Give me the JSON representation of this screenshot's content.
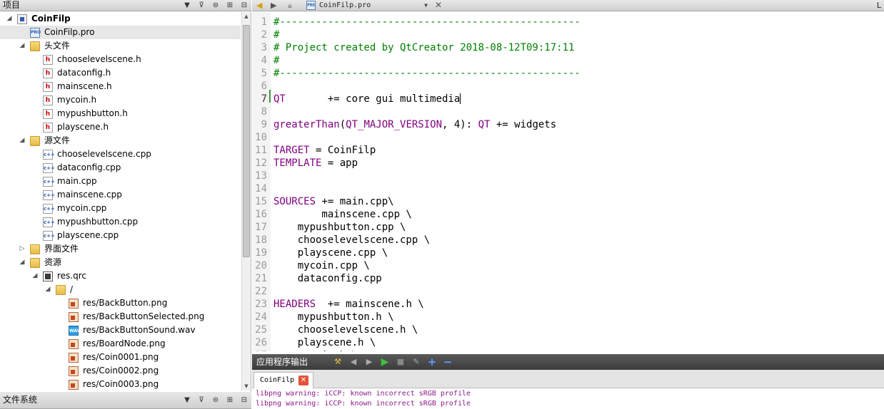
{
  "projects_panel": {
    "title": "项目",
    "tree": [
      {
        "label": "CoinFilp",
        "bold": true,
        "level": 0,
        "expanded": true,
        "icon": "project-icon"
      },
      {
        "label": "CoinFilp.pro",
        "level": 1,
        "icon": "pro-file-icon",
        "selected": true
      },
      {
        "label": "头文件",
        "level": 1,
        "expanded": true,
        "icon": "header-folder-icon"
      },
      {
        "label": "chooselevelscene.h",
        "level": 2,
        "icon": "header-file-icon"
      },
      {
        "label": "dataconfig.h",
        "level": 2,
        "icon": "header-file-icon"
      },
      {
        "label": "mainscene.h",
        "level": 2,
        "icon": "header-file-icon"
      },
      {
        "label": "mycoin.h",
        "level": 2,
        "icon": "header-file-icon"
      },
      {
        "label": "mypushbutton.h",
        "level": 2,
        "icon": "header-file-icon"
      },
      {
        "label": "playscene.h",
        "level": 2,
        "icon": "header-file-icon"
      },
      {
        "label": "源文件",
        "level": 1,
        "expanded": true,
        "icon": "source-folder-icon"
      },
      {
        "label": "chooselevelscene.cpp",
        "level": 2,
        "icon": "cpp-file-icon"
      },
      {
        "label": "dataconfig.cpp",
        "level": 2,
        "icon": "cpp-file-icon"
      },
      {
        "label": "main.cpp",
        "level": 2,
        "icon": "cpp-file-icon"
      },
      {
        "label": "mainscene.cpp",
        "level": 2,
        "icon": "cpp-file-icon"
      },
      {
        "label": "mycoin.cpp",
        "level": 2,
        "icon": "cpp-file-icon"
      },
      {
        "label": "mypushbutton.cpp",
        "level": 2,
        "icon": "cpp-file-icon"
      },
      {
        "label": "playscene.cpp",
        "level": 2,
        "icon": "cpp-file-icon"
      },
      {
        "label": "界面文件",
        "level": 1,
        "expanded": false,
        "icon": "forms-folder-icon"
      },
      {
        "label": "资源",
        "level": 1,
        "expanded": true,
        "icon": "resources-folder-icon"
      },
      {
        "label": "res.qrc",
        "level": 2,
        "expanded": true,
        "icon": "qrc-file-icon"
      },
      {
        "label": "/",
        "level": 3,
        "expanded": true,
        "icon": "folder-icon"
      },
      {
        "label": "res/BackButton.png",
        "level": 4,
        "icon": "png-file-icon"
      },
      {
        "label": "res/BackButtonSelected.png",
        "level": 4,
        "icon": "png-file-icon"
      },
      {
        "label": "res/BackButtonSound.wav",
        "level": 4,
        "icon": "wav-file-icon"
      },
      {
        "label": "res/BoardNode.png",
        "level": 4,
        "icon": "png-file-icon"
      },
      {
        "label": "res/Coin0001.png",
        "level": 4,
        "icon": "png-file-icon"
      },
      {
        "label": "res/Coin0002.png",
        "level": 4,
        "icon": "png-file-icon"
      },
      {
        "label": "res/Coin0003.png",
        "level": 4,
        "icon": "png-file-icon"
      }
    ]
  },
  "filesystem_panel": {
    "title": "文件系统"
  },
  "editor": {
    "document": "CoinFilp.pro",
    "right_label": "L",
    "current_line": 7,
    "lines": [
      [
        [
          "c",
          "#--------------------------------------------------"
        ]
      ],
      [
        [
          "c",
          "#"
        ]
      ],
      [
        [
          "c",
          "# Project created by QtCreator 2018-08-12T09:17:11"
        ]
      ],
      [
        [
          "c",
          "#"
        ]
      ],
      [
        [
          "c",
          "#--------------------------------------------------"
        ]
      ],
      [],
      [
        [
          "k",
          "QT"
        ],
        [
          "p",
          "       += core gui multimedia"
        ]
      ],
      [],
      [
        [
          "k",
          "greaterThan"
        ],
        [
          "p",
          "("
        ],
        [
          "k",
          "QT_MAJOR_VERSION"
        ],
        [
          "p",
          ", 4): "
        ],
        [
          "k",
          "QT"
        ],
        [
          "p",
          " += widgets"
        ]
      ],
      [],
      [
        [
          "k",
          "TARGET"
        ],
        [
          "p",
          " = CoinFilp"
        ]
      ],
      [
        [
          "k",
          "TEMPLATE"
        ],
        [
          "p",
          " = app"
        ]
      ],
      [],
      [],
      [
        [
          "k",
          "SOURCES"
        ],
        [
          "p",
          " += main.cpp\\"
        ]
      ],
      [
        [
          "p",
          "        mainscene.cpp \\"
        ]
      ],
      [
        [
          "p",
          "    mypushbutton.cpp \\"
        ]
      ],
      [
        [
          "p",
          "    chooselevelscene.cpp \\"
        ]
      ],
      [
        [
          "p",
          "    playscene.cpp \\"
        ]
      ],
      [
        [
          "p",
          "    mycoin.cpp \\"
        ]
      ],
      [
        [
          "p",
          "    dataconfig.cpp"
        ]
      ],
      [],
      [
        [
          "k",
          "HEADERS"
        ],
        [
          "p",
          "  += mainscene.h \\"
        ]
      ],
      [
        [
          "p",
          "    mypushbutton.h \\"
        ]
      ],
      [
        [
          "p",
          "    chooselevelscene.h \\"
        ]
      ],
      [
        [
          "p",
          "    playscene.h \\"
        ]
      ],
      [
        [
          "p",
          "    mycoin.h \\"
        ]
      ]
    ]
  },
  "output": {
    "title": "应用程序输出",
    "tab_label": "CoinFilp",
    "lines": [
      "libpng warning: iCCP: known incorrect sRGB profile",
      "libpng warning: iCCP: known incorrect sRGB profile"
    ]
  },
  "colors": {
    "comment": "#008000",
    "keyword": "#800080",
    "output_text": "#8b1a8b",
    "close_tab": "#e2543b",
    "output_bar": "#4a4a4a"
  }
}
